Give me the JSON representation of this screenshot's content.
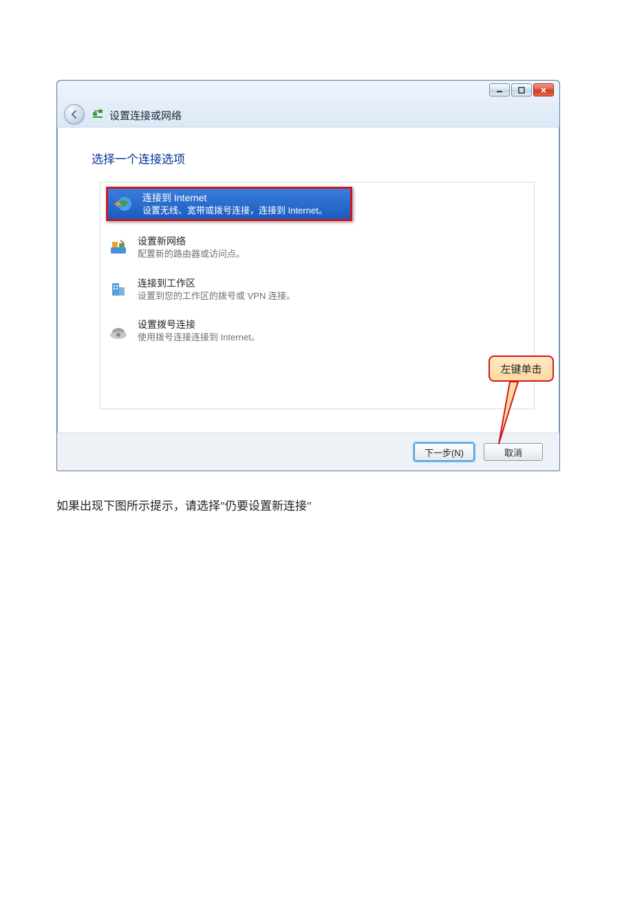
{
  "window": {
    "title": "设置连接或网络",
    "heading": "选择一个连接选项",
    "options": [
      {
        "title": "连接到 Internet",
        "desc": "设置无线、宽带或拨号连接，连接到 Internet。"
      },
      {
        "title": "设置新网络",
        "desc": "配置新的路由器或访问点。"
      },
      {
        "title": "连接到工作区",
        "desc": "设置到您的工作区的拨号或 VPN 连接。"
      },
      {
        "title": "设置拨号连接",
        "desc": "使用拨号连接连接到 Internet。"
      }
    ],
    "buttons": {
      "next": "下一步(N)",
      "cancel": "取消"
    },
    "callout": "左键单击"
  },
  "instruction": "如果出现下图所示提示，请选择\"仍要设置新连接\""
}
